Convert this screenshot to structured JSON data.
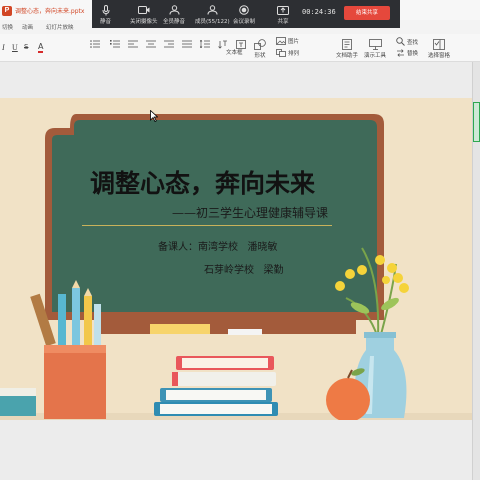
{
  "window": {
    "doc_title": "调整心态，奔向未来.pptx"
  },
  "meeting_bar": {
    "mic_label": "静音",
    "camera_label": "关闭摄像头",
    "mute_all_label": "全员静音",
    "members_label": "成员(55/122)",
    "record_label": "会议录制",
    "share_label": "共享",
    "timer": "00:24:36",
    "stop_share_label": "结束共享",
    "stop_color": "#e5483c"
  },
  "menu": {
    "tabs": [
      "切换",
      "动画",
      "幻灯片放映"
    ]
  },
  "ribbon": {
    "textbox": "文本框",
    "shape": "形状",
    "image": "图片",
    "arrange": "排列",
    "assistant": "文档助手",
    "presenter": "演示工具",
    "find": "查找",
    "replace": "替换",
    "select_pane": "选择窗格"
  },
  "slide": {
    "title": "调整心态，奔向未来",
    "subtitle": "——初三学生心理健康辅导课",
    "preparer_label": "备课人：南湾学校   潘晓敏",
    "preparer_second": "石芽岭学校   梁勤",
    "board_color": "#3d6b5a",
    "frame_color": "#a0583a",
    "accent_color": "#e67e4b"
  }
}
